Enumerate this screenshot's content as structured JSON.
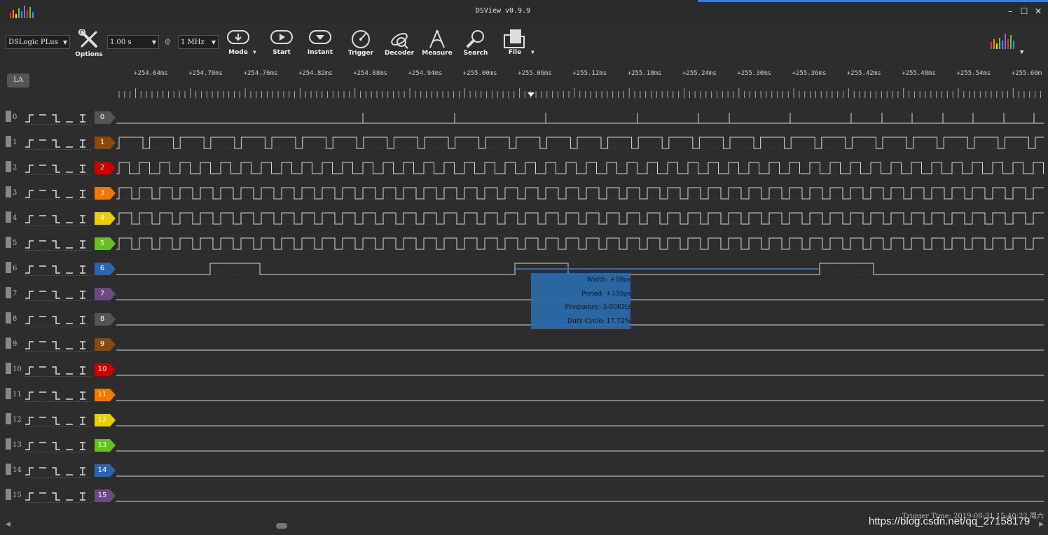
{
  "window": {
    "title": "DSView v0.9.9",
    "minimize": "–",
    "maximize": "☐",
    "close": "✕"
  },
  "toolbar": {
    "device": "DSLogic PLus",
    "duration": "1.00 s",
    "at": "@",
    "samplerate": "1 MHz",
    "options_label": "Options",
    "mode_label": "Mode",
    "start_label": "Start",
    "instant_label": "Instant",
    "trigger_label": "Trigger",
    "decoder_label": "Decoder",
    "measure_label": "Measure",
    "search_label": "Search",
    "file_label": "File"
  },
  "la_button": "LA",
  "ruler": {
    "labels": [
      "+254.64ms",
      "+254.70ms",
      "+254.76ms",
      "+254.82ms",
      "+254.88ms",
      "+254.94ms",
      "+255.00ms",
      "+255.06ms",
      "+255.12ms",
      "+255.18ms",
      "+255.24ms",
      "+255.30ms",
      "+255.36ms",
      "+255.42ms",
      "+255.48ms",
      "+255.54ms",
      "+255.60m"
    ]
  },
  "channels": [
    {
      "index": "0",
      "color": "#555555"
    },
    {
      "index": "1",
      "color": "#8a4a0c"
    },
    {
      "index": "2",
      "color": "#cc0000"
    },
    {
      "index": "3",
      "color": "#f07800"
    },
    {
      "index": "4",
      "color": "#e8d000"
    },
    {
      "index": "5",
      "color": "#66c020"
    },
    {
      "index": "6",
      "color": "#2a66b0"
    },
    {
      "index": "7",
      "color": "#6a4a80"
    },
    {
      "index": "8",
      "color": "#555555"
    },
    {
      "index": "9",
      "color": "#8a4a0c"
    },
    {
      "index": "10",
      "color": "#cc0000"
    },
    {
      "index": "11",
      "color": "#f07800"
    },
    {
      "index": "12",
      "color": "#e8d000"
    },
    {
      "index": "13",
      "color": "#66c020"
    },
    {
      "index": "14",
      "color": "#2a66b0"
    },
    {
      "index": "15",
      "color": "#6a4a80"
    }
  ],
  "measurement": {
    "width": "Width: +59μs",
    "period": "Period: +333μs",
    "frequency": "Frequency: 3.00KHz",
    "duty_cycle": "Duty Cycle: 17.72%"
  },
  "status": {
    "trigger_time": "Trigger Time: 2019-08-31 15:40:22 周六"
  },
  "watermark": "https://blog.csdn.net/qq_27158179",
  "colors": {
    "background": "#2d2d2d",
    "waveform": "#d8d8d8",
    "measure_box": "#2a6aa8"
  }
}
